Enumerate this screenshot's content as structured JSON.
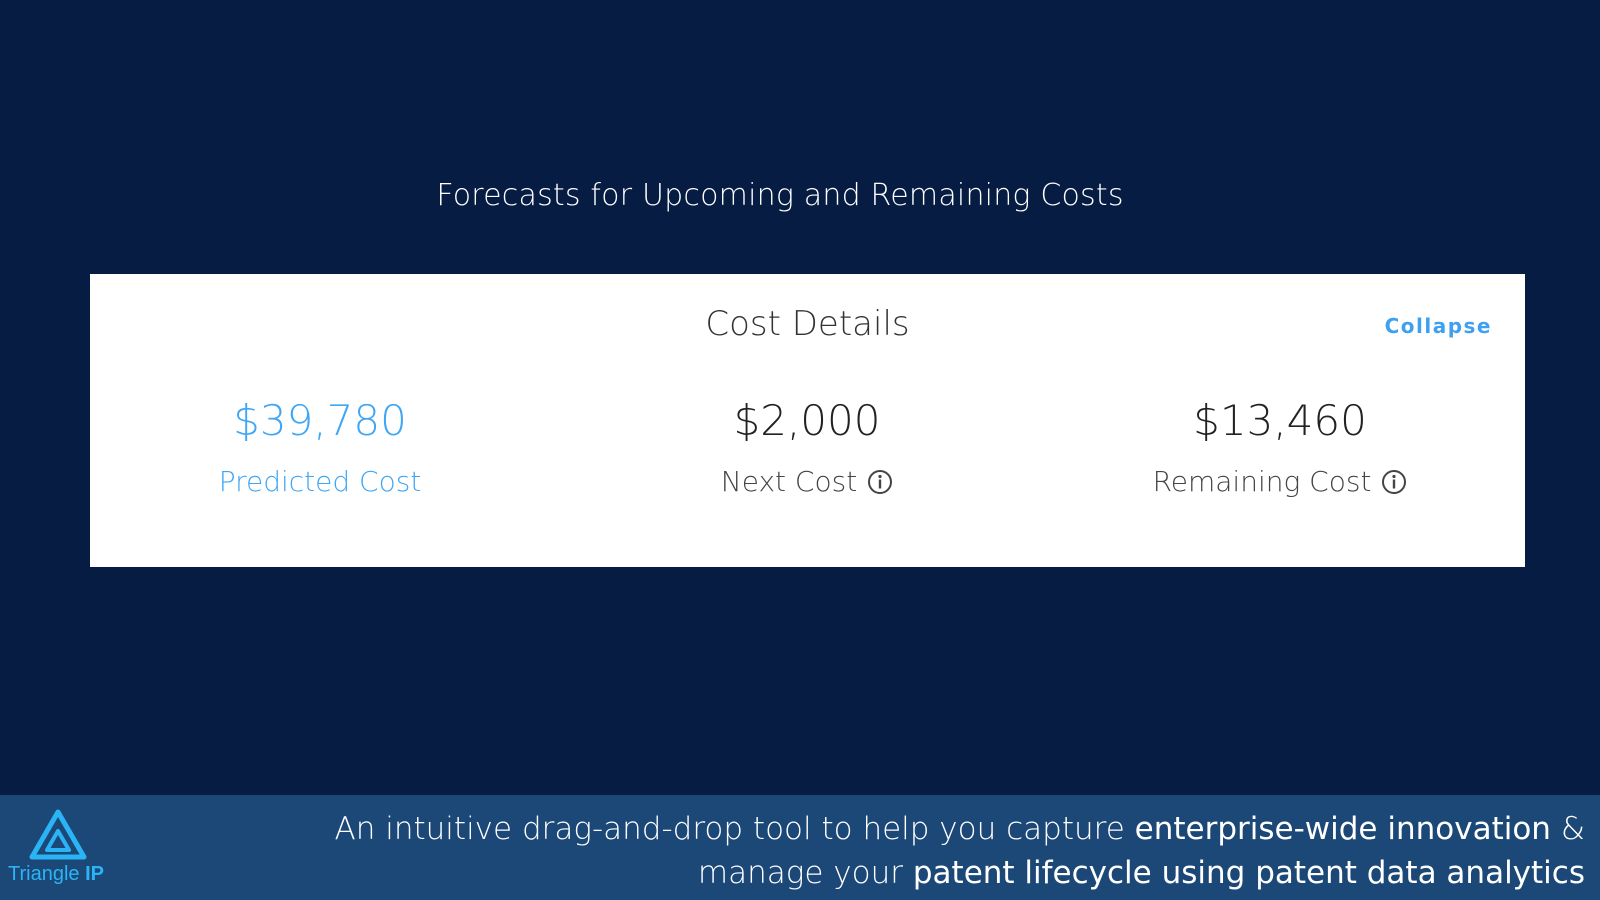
{
  "page": {
    "heading": "Forecasts for Upcoming and Remaining Costs"
  },
  "card": {
    "title": "Cost Details",
    "collapse_label": "Collapse",
    "metrics": [
      {
        "value": "$39,780",
        "label": "Predicted Cost",
        "info_icon": false
      },
      {
        "value": "$2,000",
        "label": "Next Cost",
        "info_icon": true
      },
      {
        "value": "$13,460",
        "label": "Remaining Cost",
        "info_icon": true
      }
    ]
  },
  "footer": {
    "logo_text_light": "Triangle",
    "logo_text_bold": "IP",
    "logo_icon": "triangle-logo-icon",
    "tagline_line1_plain": "An intuitive drag-and-drop tool to help you capture",
    "tagline_line1_highlight": "enterprise-wide innovation",
    "tagline_line1_end": "&",
    "tagline_line2_plain": "manage your",
    "tagline_line2_highlight": "patent lifecycle using patent data analytics"
  },
  "colors": {
    "background": "#061c42",
    "footer": "#1c4877",
    "accent": "#3fa6f5",
    "logo": "#2bb4f5"
  }
}
